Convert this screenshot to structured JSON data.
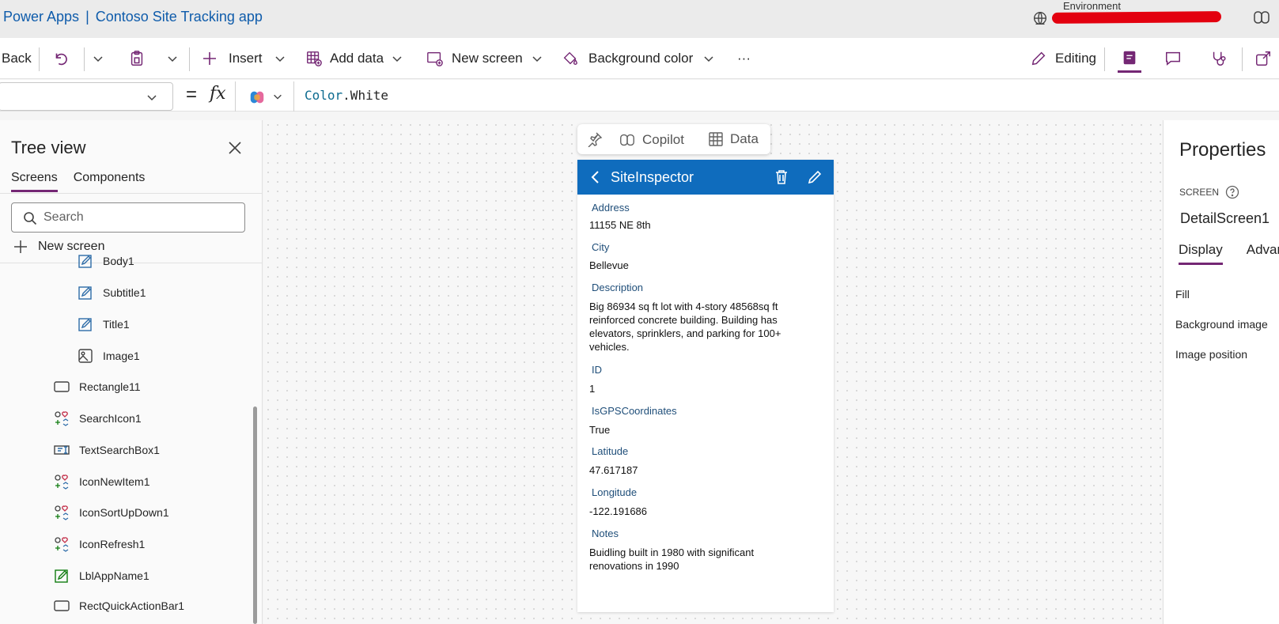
{
  "titlebar": {
    "product": "Power Apps",
    "separator": "|",
    "app_name": "Contoso Site Tracking app",
    "environment_label": "Environment"
  },
  "toolbar": {
    "back": "Back",
    "insert": "Insert",
    "add_data": "Add data",
    "new_screen": "New screen",
    "background_color": "Background color",
    "more": "···",
    "editing": "Editing"
  },
  "formula_bar": {
    "equals": "=",
    "fx": "fx",
    "formula_keyword": "Color",
    "formula_rest": ".White"
  },
  "tree_view": {
    "title": "Tree view",
    "tabs": [
      "Screens",
      "Components"
    ],
    "search_placeholder": "Search",
    "new_screen": "New screen",
    "items": [
      {
        "label": "Body1",
        "icon": "edit-label-icon"
      },
      {
        "label": "Subtitle1",
        "icon": "edit-label-icon"
      },
      {
        "label": "Title1",
        "icon": "edit-label-icon"
      },
      {
        "label": "Image1",
        "icon": "image-icon"
      },
      {
        "label": "Rectangle11",
        "icon": "rectangle-icon"
      },
      {
        "label": "SearchIcon1",
        "icon": "icons-control-icon"
      },
      {
        "label": "TextSearchBox1",
        "icon": "text-input-icon"
      },
      {
        "label": "IconNewItem1",
        "icon": "icons-control-icon"
      },
      {
        "label": "IconSortUpDown1",
        "icon": "icons-control-icon"
      },
      {
        "label": "IconRefresh1",
        "icon": "icons-control-icon"
      },
      {
        "label": "LblAppName1",
        "icon": "edit-label-icon"
      },
      {
        "label": "RectQuickActionBar1",
        "icon": "rectangle-icon"
      }
    ]
  },
  "canvas": {
    "floating_bar": {
      "copilot": "Copilot",
      "data": "Data"
    },
    "screen": {
      "title": "SiteInspector",
      "fields": [
        {
          "label": "Address",
          "value": "11155 NE 8th"
        },
        {
          "label": "City",
          "value": "Bellevue"
        },
        {
          "label": "Description",
          "value": "Big 86934 sq ft lot with 4-story 48568sq ft reinforced concrete building. Building has elevators, sprinklers, and parking for 100+ vehicles."
        },
        {
          "label": "ID",
          "value": "1"
        },
        {
          "label": "IsGPSCoordinates",
          "value": "True"
        },
        {
          "label": "Latitude",
          "value": "47.617187"
        },
        {
          "label": "Longitude",
          "value": "-122.191686"
        },
        {
          "label": "Notes",
          "value": "Buidling built  in 1980 with significant renovations in 1990"
        }
      ]
    }
  },
  "properties": {
    "title": "Properties",
    "type_label": "SCREEN",
    "screen_name": "DetailScreen1",
    "tabs": [
      "Display",
      "Advan"
    ],
    "rows": [
      "Fill",
      "Background image",
      "Image position"
    ]
  },
  "colors": {
    "accent": "#742774",
    "header_blue": "#0f6cbd",
    "brand_blue": "#0f5cab"
  }
}
